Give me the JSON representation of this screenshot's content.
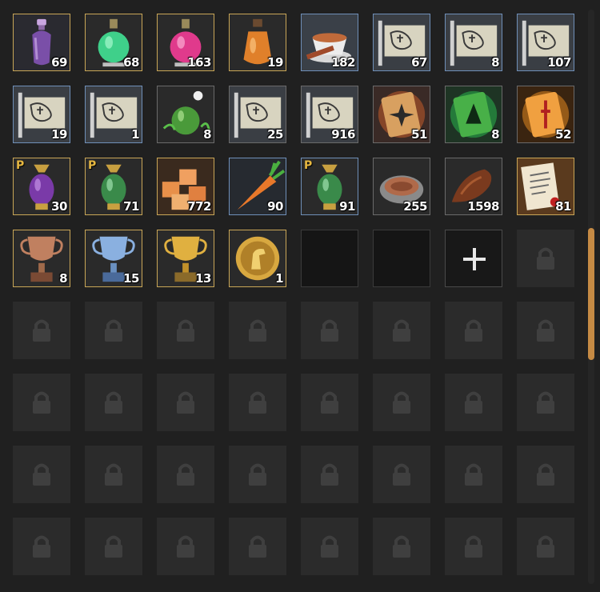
{
  "inventory": {
    "slots": [
      {
        "state": "item",
        "icon": "purple-potion-bottle-icon",
        "count": "69",
        "frame": "gold",
        "premium": false
      },
      {
        "state": "item",
        "icon": "green-potion-flask-icon",
        "count": "68",
        "frame": "gold",
        "premium": false
      },
      {
        "state": "item",
        "icon": "pink-potion-flask-icon",
        "count": "163",
        "frame": "gold",
        "premium": false
      },
      {
        "state": "item",
        "icon": "orange-potion-flask-icon",
        "count": "19",
        "frame": "gold",
        "premium": false
      },
      {
        "state": "item",
        "icon": "tea-cup-icon",
        "count": "182",
        "frame": "blue",
        "premium": false
      },
      {
        "state": "item",
        "icon": "map-scroll-icon",
        "count": "67",
        "frame": "blue",
        "premium": false
      },
      {
        "state": "item",
        "icon": "map-scroll-icon",
        "count": "8",
        "frame": "blue",
        "premium": false
      },
      {
        "state": "item",
        "icon": "map-scroll-icon",
        "count": "107",
        "frame": "blue",
        "premium": false
      },
      {
        "state": "item",
        "icon": "map-scroll-icon",
        "count": "19",
        "frame": "blue",
        "premium": false
      },
      {
        "state": "item",
        "icon": "map-scroll-icon",
        "count": "1",
        "frame": "blue",
        "premium": false
      },
      {
        "state": "item",
        "icon": "herbal-potion-icon",
        "count": "8",
        "frame": "gray",
        "premium": false
      },
      {
        "state": "item",
        "icon": "map-scroll-icon",
        "count": "25",
        "frame": "gray",
        "premium": false
      },
      {
        "state": "item",
        "icon": "map-scroll-icon",
        "count": "916",
        "frame": "gray",
        "premium": false
      },
      {
        "state": "item",
        "icon": "red-magic-scroll-icon",
        "count": "51",
        "frame": "gray",
        "premium": false
      },
      {
        "state": "item",
        "icon": "green-magic-scroll-icon",
        "count": "8",
        "frame": "gray",
        "premium": false
      },
      {
        "state": "item",
        "icon": "orange-magic-scroll-icon",
        "count": "52",
        "frame": "gray",
        "premium": false
      },
      {
        "state": "item",
        "icon": "purple-elixir-vase-icon",
        "count": "30",
        "frame": "gold",
        "premium": true
      },
      {
        "state": "item",
        "icon": "green-elixir-vase-icon",
        "count": "71",
        "frame": "gold",
        "premium": true
      },
      {
        "state": "item",
        "icon": "sugar-cubes-icon",
        "count": "772",
        "frame": "gold",
        "premium": false
      },
      {
        "state": "item",
        "icon": "carrot-icon",
        "count": "90",
        "frame": "blue",
        "premium": false
      },
      {
        "state": "item",
        "icon": "green-elixir-vase-icon",
        "count": "91",
        "frame": "blue",
        "premium": true
      },
      {
        "state": "item",
        "icon": "feed-bowl-icon",
        "count": "255",
        "frame": "gray",
        "premium": false
      },
      {
        "state": "item",
        "icon": "dried-meat-icon",
        "count": "1598",
        "frame": "gray",
        "premium": false
      },
      {
        "state": "item",
        "icon": "certificate-document-icon",
        "count": "81",
        "frame": "gold",
        "premium": false
      },
      {
        "state": "item",
        "icon": "bronze-trophy-icon",
        "count": "8",
        "frame": "gold",
        "premium": false
      },
      {
        "state": "item",
        "icon": "silver-trophy-icon",
        "count": "15",
        "frame": "gold",
        "premium": false
      },
      {
        "state": "item",
        "icon": "gold-trophy-icon",
        "count": "13",
        "frame": "gold",
        "premium": false
      },
      {
        "state": "item",
        "icon": "horse-medal-icon",
        "count": "1",
        "frame": "gold",
        "premium": false
      },
      {
        "state": "empty"
      },
      {
        "state": "empty"
      },
      {
        "state": "add",
        "icon": "plus-icon"
      },
      {
        "state": "locked",
        "icon": "lock-icon"
      },
      {
        "state": "locked",
        "icon": "lock-icon"
      },
      {
        "state": "locked",
        "icon": "lock-icon"
      },
      {
        "state": "locked",
        "icon": "lock-icon"
      },
      {
        "state": "locked",
        "icon": "lock-icon"
      },
      {
        "state": "locked",
        "icon": "lock-icon"
      },
      {
        "state": "locked",
        "icon": "lock-icon"
      },
      {
        "state": "locked",
        "icon": "lock-icon"
      },
      {
        "state": "locked",
        "icon": "lock-icon"
      },
      {
        "state": "locked",
        "icon": "lock-icon"
      },
      {
        "state": "locked",
        "icon": "lock-icon"
      },
      {
        "state": "locked",
        "icon": "lock-icon"
      },
      {
        "state": "locked",
        "icon": "lock-icon"
      },
      {
        "state": "locked",
        "icon": "lock-icon"
      },
      {
        "state": "locked",
        "icon": "lock-icon"
      },
      {
        "state": "locked",
        "icon": "lock-icon"
      },
      {
        "state": "locked",
        "icon": "lock-icon"
      },
      {
        "state": "locked",
        "icon": "lock-icon"
      },
      {
        "state": "locked",
        "icon": "lock-icon"
      },
      {
        "state": "locked",
        "icon": "lock-icon"
      },
      {
        "state": "locked",
        "icon": "lock-icon"
      },
      {
        "state": "locked",
        "icon": "lock-icon"
      },
      {
        "state": "locked",
        "icon": "lock-icon"
      },
      {
        "state": "locked",
        "icon": "lock-icon"
      },
      {
        "state": "locked",
        "icon": "lock-icon"
      },
      {
        "state": "locked",
        "icon": "lock-icon"
      },
      {
        "state": "locked",
        "icon": "lock-icon"
      },
      {
        "state": "locked",
        "icon": "lock-icon"
      },
      {
        "state": "locked",
        "icon": "lock-icon"
      },
      {
        "state": "locked",
        "icon": "lock-icon"
      },
      {
        "state": "locked",
        "icon": "lock-icon"
      },
      {
        "state": "locked",
        "icon": "lock-icon"
      },
      {
        "state": "locked",
        "icon": "lock-icon"
      }
    ],
    "premium_badge": "P"
  },
  "scrollbar": {
    "position_fraction": 0.38,
    "visible_fraction": 0.23,
    "thumb_color": "#c58a44"
  },
  "colors": {
    "background": "#202020",
    "frame_gold": "#c9a657",
    "frame_blue": "#6f8fb8",
    "locked_slot": "#2b2b2b"
  }
}
